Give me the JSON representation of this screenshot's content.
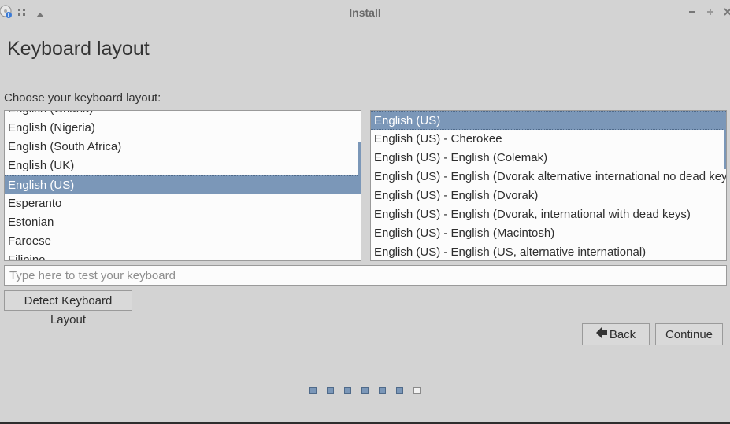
{
  "window": {
    "title": "Install"
  },
  "page": {
    "heading": "Keyboard layout",
    "choose_label": "Choose your keyboard layout:"
  },
  "layouts": {
    "items": [
      "English (Ghana)",
      "English (Nigeria)",
      "English (South Africa)",
      "English (UK)",
      "English (US)",
      "Esperanto",
      "Estonian",
      "Faroese",
      "Filipino"
    ],
    "selected": "English (US)"
  },
  "variants": {
    "items": [
      "English (US)",
      "English (US) - Cherokee",
      "English (US) - English (Colemak)",
      "English (US) - English (Dvorak alternative international no dead keys)",
      "English (US) - English (Dvorak)",
      "English (US) - English (Dvorak, international with dead keys)",
      "English (US) - English (Macintosh)",
      "English (US) - English (US, alternative international)"
    ],
    "selected": "English (US)"
  },
  "test_input": {
    "placeholder": "Type here to test your keyboard",
    "value": ""
  },
  "buttons": {
    "detect": "Detect Keyboard Layout",
    "back": "Back",
    "continue": "Continue"
  },
  "progress": {
    "total_steps": 7,
    "completed_steps": 6
  },
  "colors": {
    "selection": "#7b97b8",
    "background": "#d3d3d3",
    "list_background": "#fcfcfc"
  }
}
